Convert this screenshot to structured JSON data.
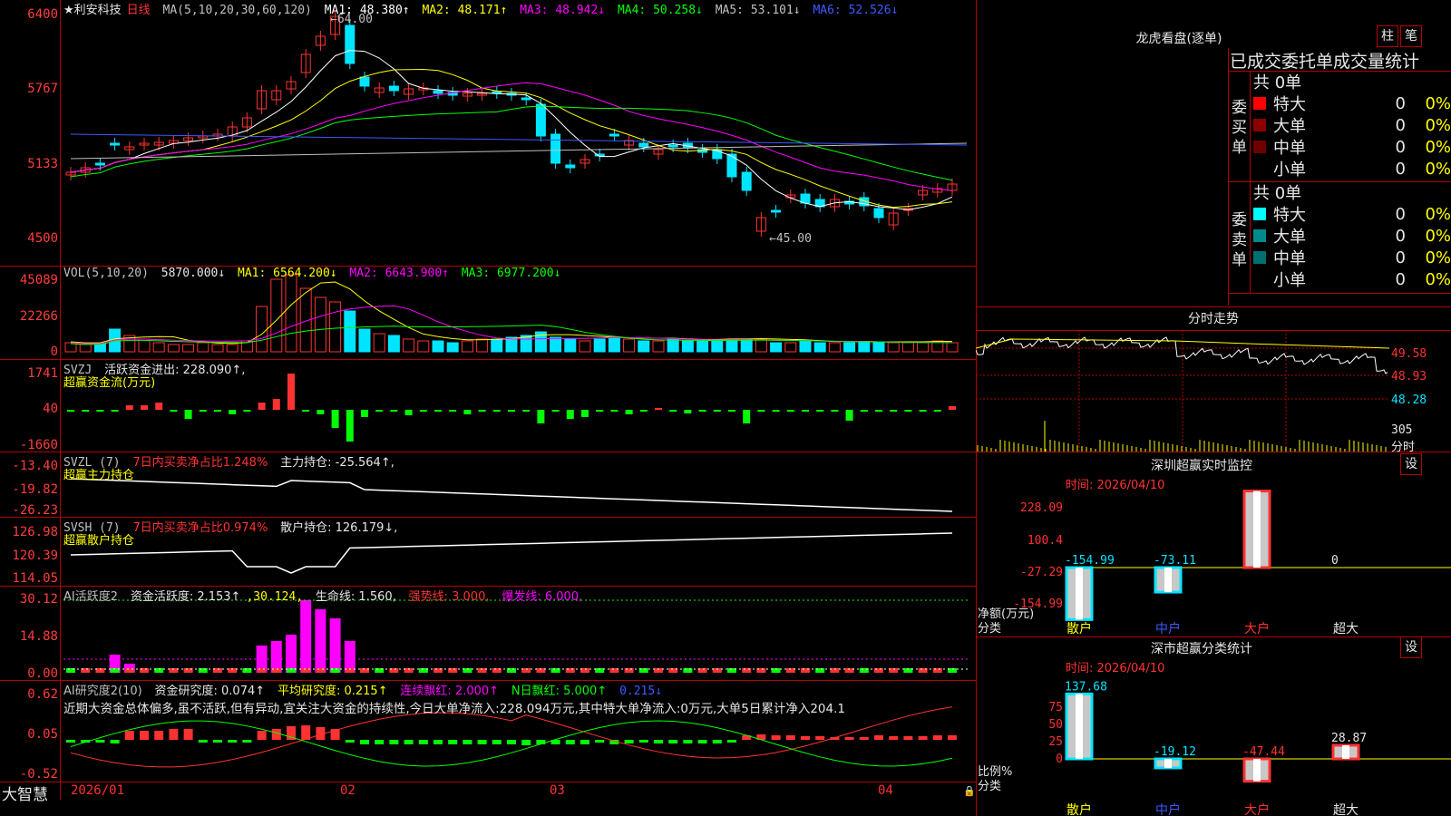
{
  "colors": {
    "up": "#ff3232",
    "down": "#00e5ff",
    "grid": "#b40000",
    "yellow": "#ffff00",
    "white": "#ffffff",
    "magenta": "#ff00ff",
    "green": "#00ff00"
  },
  "kline": {
    "stock": "★利安科技",
    "period": "日线",
    "ma_label": "MA(5,10,20,30,60,120)",
    "ma1": "MA1: 48.380↑",
    "ma2": "MA2: 48.171↑",
    "ma3": "MA3: 48.942↓",
    "ma4": "MA4: 50.258↓",
    "ma5": "MA5: 53.101↓",
    "ma6": "MA6: 52.526↓",
    "high_marker": "64.00",
    "low_marker": "45.00",
    "yticks": [
      "6400",
      "5767",
      "5133",
      "4500"
    ]
  },
  "vol": {
    "label": "VOL(5,10,20)",
    "value": "5870.000↓",
    "ma1": "MA1: 6564.200↓",
    "ma2": "MA2: 6643.900↑",
    "ma3": "MA3: 6977.200↓",
    "yticks": [
      "45089",
      "22266",
      "0"
    ]
  },
  "svzj": {
    "label": "SVZJ",
    "desc": "活跃资金进出: 228.090↑,",
    "sub": "超赢资金流(万元)",
    "yticks": [
      "1741",
      "40",
      "-1660"
    ]
  },
  "svzl": {
    "label": "SVZL (7)",
    "desc1": "7日内买卖净占比1.248%",
    "desc2": "主力持仓: -25.564↑,",
    "sub": "超赢主力持仓",
    "yticks": [
      "-13.40",
      "-19.82",
      "-26.23"
    ]
  },
  "svsh": {
    "label": "SVSH (7)",
    "desc1": "7日内买卖净占比0.974%",
    "desc2": "散户持仓: 126.179↓,",
    "sub": "超赢散户持仓",
    "yticks": [
      "126.98",
      "120.39",
      "114.05"
    ]
  },
  "ai1": {
    "label": "AI活跃度2",
    "a": "资金活跃度: 2.153↑",
    "b": ",30.124,",
    "c": "生命线: 1.560,",
    "d": "强势线: 3.000,",
    "e": "爆发线: 6.000,",
    "yticks": [
      "30.12",
      "14.88",
      "0.00"
    ]
  },
  "ai2": {
    "label": "AI研究度2(10)",
    "a": "资金研究度: 0.074↑",
    "b": "平均研究度: 0.215↑",
    "c": "连续飘红: 2.000↑",
    "d": "N日飘红: 5.000↑",
    "e": "0.215↓",
    "comment": "近期大资金总体偏多,虽不活跃,但有异动,宜关注大资金的持续性,今日大单净流入:228.094万元,其中特大单净流入:0万元,大单5日累计净入204.1",
    "yticks": [
      "0.62",
      "0.05",
      "-0.52"
    ]
  },
  "xaxis": {
    "brand": "大智慧",
    "labels": [
      "2026/01",
      "02",
      "03",
      "04"
    ]
  },
  "dragon": {
    "title": "龙虎看盘(逐单)",
    "btn1": "柱",
    "btn2": "笔",
    "subtitle": "已成交委托单成交量统计",
    "buy": {
      "side": "委买单",
      "total": "共 0单",
      "rows": [
        {
          "name": "特大",
          "n": "0",
          "p": "0%",
          "c": "#ff0000"
        },
        {
          "name": "大单",
          "n": "0",
          "p": "0%",
          "c": "#8b0000"
        },
        {
          "name": "中单",
          "n": "0",
          "p": "0%",
          "c": "#6e0000"
        },
        {
          "name": "小单",
          "n": "0",
          "p": "0%",
          "c": "#000000"
        }
      ]
    },
    "sell": {
      "side": "委卖单",
      "total": "共 0单",
      "rows": [
        {
          "name": "特大",
          "n": "0",
          "p": "0%",
          "c": "#00ffff"
        },
        {
          "name": "大单",
          "n": "0",
          "p": "0%",
          "c": "#008b8b"
        },
        {
          "name": "中单",
          "n": "0",
          "p": "0%",
          "c": "#007070"
        },
        {
          "name": "小单",
          "n": "0",
          "p": "0%",
          "c": "#000000"
        }
      ]
    }
  },
  "intraday": {
    "title": "分时走势",
    "yticks": [
      "49.58",
      "48.93",
      "48.28"
    ],
    "vol_top": "305",
    "vol_unit": "分时"
  },
  "sz_monitor": {
    "title": "深圳超赢实时监控",
    "btn": "设",
    "time": "时间: 2026/04/10",
    "yticks": [
      "228.09",
      "100.4",
      "-27.29",
      "-154.99"
    ],
    "cats": [
      "散户",
      "中户",
      "大户",
      "超大"
    ],
    "values": [
      -154.99,
      -73.11,
      228.09,
      0
    ],
    "labels": [
      "-154.99",
      "-73.11",
      "228.09",
      "0"
    ],
    "ylabel": "净额(万元)",
    "xlabel": "分类"
  },
  "sz_class": {
    "title": "深市超赢分类统计",
    "btn": "设",
    "time": "时间: 2026/04/10",
    "yticks": [
      "75",
      "50",
      "25",
      "0"
    ],
    "cats": [
      "散户",
      "中户",
      "大户",
      "超大"
    ],
    "values": [
      137.68,
      -19.12,
      -47.44,
      28.87
    ],
    "labels": [
      "137.68",
      "-19.12",
      "-47.44",
      "28.87"
    ],
    "ylabel": "比例%",
    "xlabel": "分类"
  }
}
